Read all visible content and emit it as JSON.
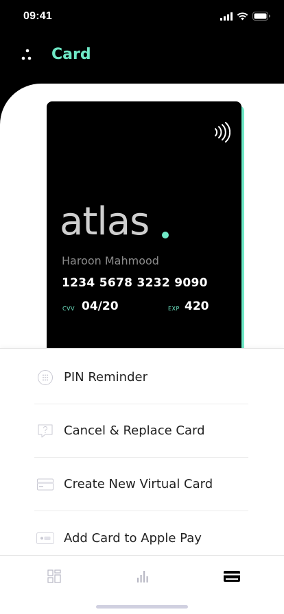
{
  "status_bar": {
    "time": "09:41"
  },
  "header": {
    "title": "Card",
    "menu_icon": "dots-menu-icon"
  },
  "card": {
    "brand": "atlas",
    "holder_name": "Haroon Mahmood",
    "number": "1234 5678 3232 9090",
    "cvv_label": "CVV",
    "cvv_value": "04/20",
    "exp_label": "EXP",
    "exp_value": "420",
    "accent_color": "#6fe8c6"
  },
  "actions": [
    {
      "label": "PIN Reminder",
      "icon": "keypad-icon"
    },
    {
      "label": "Cancel & Replace Card",
      "icon": "help-bubble-icon"
    },
    {
      "label": "Create New Virtual Card",
      "icon": "card-icon"
    },
    {
      "label": "Add Card to Apple Pay",
      "icon": "apple-pay-icon"
    }
  ],
  "tab_bar": {
    "tabs": [
      {
        "name": "dashboard",
        "icon": "grid-icon",
        "active": false
      },
      {
        "name": "stats",
        "icon": "bar-chart-icon",
        "active": false
      },
      {
        "name": "card",
        "icon": "credit-card-icon",
        "active": true
      }
    ]
  }
}
